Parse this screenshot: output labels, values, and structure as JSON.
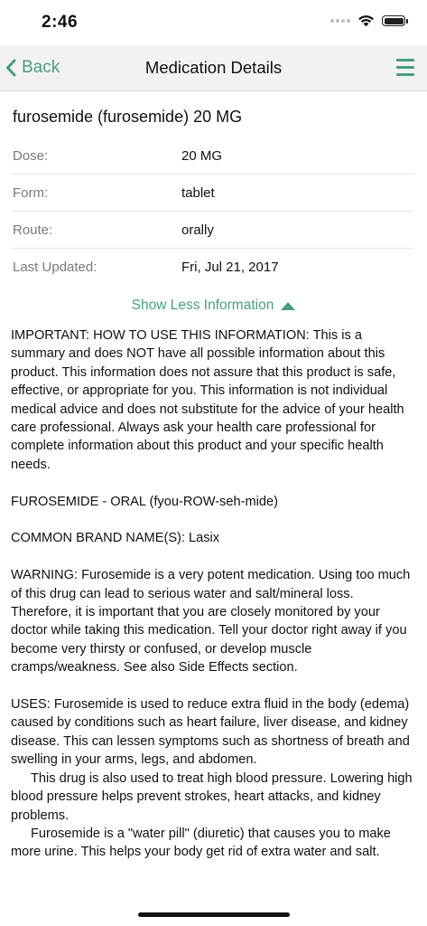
{
  "status_bar": {
    "time": "2:46"
  },
  "nav": {
    "back_label": "Back",
    "title": "Medication Details"
  },
  "medication": {
    "title": "furosemide (furosemide) 20 MG",
    "details": [
      {
        "label": "Dose:",
        "value": "20 MG"
      },
      {
        "label": "Form:",
        "value": "tablet"
      },
      {
        "label": "Route:",
        "value": "orally"
      },
      {
        "label": "Last Updated:",
        "value": "Fri, Jul 21, 2017"
      }
    ]
  },
  "toggle": {
    "label": "Show Less Information"
  },
  "info": {
    "important": "IMPORTANT: HOW TO USE THIS INFORMATION: This is a summary and does NOT have all possible information about this product. This information does not assure that this product is safe, effective, or appropriate for you. This information is not individual medical advice and does not substitute for the advice of your health care professional. Always ask your health care professional for complete information about this product and your specific health needs.",
    "drug_name": "FUROSEMIDE - ORAL (fyou-ROW-seh-mide)",
    "brand_names": "COMMON BRAND NAME(S): Lasix",
    "warning": "WARNING: Furosemide is a very potent medication. Using too much of this drug can lead to serious water and salt/mineral loss. Therefore, it is important that you are closely monitored by your doctor while taking this medication. Tell your doctor right away if you become very thirsty or confused, or develop muscle cramps/weakness. See also Side Effects section.",
    "uses_1": "USES: Furosemide is used to reduce extra fluid in the body (edema) caused by conditions such as heart failure, liver disease, and kidney disease. This can lessen symptoms such as shortness of breath and swelling in your arms, legs, and abdomen.",
    "uses_2": "This drug is also used to treat high blood pressure. Lowering high blood pressure helps prevent strokes, heart attacks, and kidney problems.",
    "uses_3": "Furosemide is a \"water pill\" (diuretic) that causes you to make more urine. This helps your body get rid of extra water and salt."
  },
  "colors": {
    "accent": "#4a9d7c",
    "nav_background": "#f2f2f2"
  },
  "icons": {
    "back": "chevron-left-icon",
    "menu": "hamburger-menu-icon",
    "toggle": "triangle-up-icon",
    "wifi": "wifi-icon",
    "battery": "battery-icon",
    "signal": "cellular-signal-icon"
  },
  "battery_level": 1.0
}
